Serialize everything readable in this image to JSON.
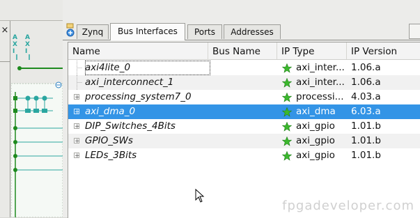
{
  "tabs": [
    {
      "label": "Zynq",
      "active": false
    },
    {
      "label": "Bus Interfaces",
      "active": true
    },
    {
      "label": "Ports",
      "active": false
    },
    {
      "label": "Addresses",
      "active": false
    }
  ],
  "columns": [
    "Name",
    "Bus Name",
    "IP Type",
    "IP Version"
  ],
  "rows": [
    {
      "name": "axi4lite_0",
      "bus_name": "",
      "ip_type": "",
      "ip_version": "1.06.a",
      "expandable": false,
      "focused": true,
      "selected": false
    },
    {
      "name": "axi_interconnect_1",
      "bus_name": "",
      "ip_type": "axi_inter...",
      "ip_version": "1.06.a",
      "expandable": false,
      "focused": false,
      "selected": false
    },
    {
      "name": "processing_system7_0",
      "bus_name": "",
      "ip_type": "processi...",
      "ip_version": "4.03.a",
      "expandable": true,
      "focused": false,
      "selected": false
    },
    {
      "name": "axi_dma_0",
      "bus_name": "",
      "ip_type": "axi_dma",
      "ip_version": "6.03.a",
      "expandable": true,
      "focused": false,
      "selected": true
    },
    {
      "name": "DIP_Switches_4Bits",
      "bus_name": "",
      "ip_type": "axi_gpio",
      "ip_version": "1.01.b",
      "expandable": true,
      "focused": false,
      "selected": false
    },
    {
      "name": "GPIO_SWs",
      "bus_name": "",
      "ip_type": "axi_gpio",
      "ip_version": "1.01.b",
      "expandable": true,
      "focused": false,
      "selected": false
    },
    {
      "name": "LEDs_3Bits",
      "bus_name": "",
      "ip_type": "axi_gpio",
      "ip_version": "1.01.b",
      "expandable": true,
      "focused": false,
      "selected": false
    }
  ],
  "row0_ip_type": "axi_inter...",
  "left_pane": {
    "close_glyph": "×",
    "legend": [
      "AXI",
      "AXI"
    ]
  },
  "colors": {
    "selection": "#3394e6",
    "star": "#3cb82e",
    "header_bg": "#f4f4f4"
  },
  "icons": {
    "add_ip": "add-ip-icon",
    "star": "star-icon",
    "close": "close-icon"
  },
  "watermark": "fpgadeveloper.com"
}
